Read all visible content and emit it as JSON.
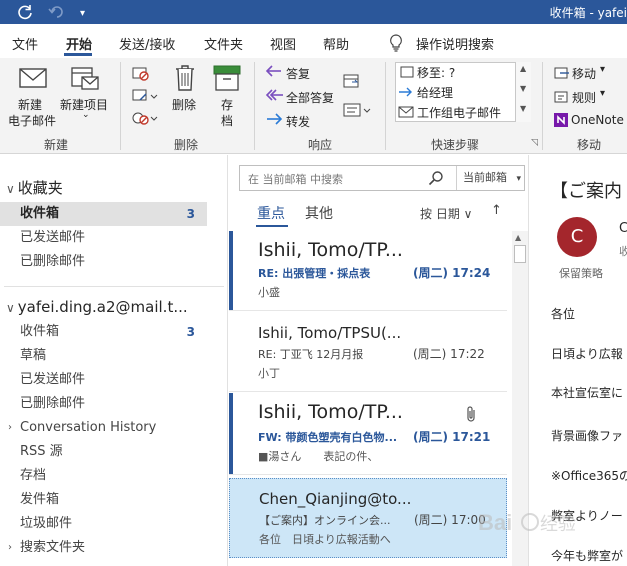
{
  "titlebar": {
    "title": "收件箱 - yafei",
    "sync_icon": "sync-icon",
    "undo_icon": "undo-icon",
    "customize_icon": "customize-quick-access-icon"
  },
  "tabs": [
    {
      "label": "文件"
    },
    {
      "label": "开始",
      "active": true
    },
    {
      "label": "发送/接收"
    },
    {
      "label": "文件夹"
    },
    {
      "label": "视图"
    },
    {
      "label": "帮助"
    }
  ],
  "tell_me": "操作说明搜索",
  "ribbon": {
    "new_email": "新建\n电子邮件",
    "new_email_l1": "新建",
    "new_email_l2": "电子邮件",
    "new_items": "新建项目",
    "group_new": "新建",
    "delete": "删除",
    "archive_l1": "存",
    "archive_l2": "档",
    "group_delete": "删除",
    "reply": "答复",
    "reply_all": "全部答复",
    "forward": "转发",
    "group_respond": "响应",
    "quick_steps": [
      {
        "label": "移至: ?"
      },
      {
        "label": "给经理"
      },
      {
        "label": "工作组电子邮件"
      }
    ],
    "group_quick_steps": "快速步骤",
    "move": "移动",
    "rules": "规则",
    "onenote": "OneNote",
    "group_move": "移动"
  },
  "nav": {
    "favorites": "收藏夹",
    "fav_items": [
      {
        "label": "收件箱",
        "count": "3",
        "selected": true
      },
      {
        "label": "已发送邮件"
      },
      {
        "label": "已删除邮件"
      }
    ],
    "account": "yafei.ding.a2@mail.t...",
    "account_items": [
      {
        "label": "收件箱",
        "count": "3"
      },
      {
        "label": "草稿"
      },
      {
        "label": "已发送邮件"
      },
      {
        "label": "已删除邮件"
      },
      {
        "label": "Conversation History",
        "expand": true
      },
      {
        "label": "RSS 源"
      },
      {
        "label": "存档"
      },
      {
        "label": "发件箱"
      },
      {
        "label": "垃圾邮件"
      },
      {
        "label": "搜索文件夹",
        "expand": true
      }
    ]
  },
  "list": {
    "search_placeholder": "在 当前邮箱 中搜索",
    "scope": "当前邮箱",
    "tab_focused": "重点",
    "tab_other": "其他",
    "sort": "按 日期 ∨",
    "sort_dir": "↑",
    "messages": [
      {
        "from": "Ishii, Tomo/TP...",
        "subject": "RE: 出張管理・採点表",
        "time": "(周二) 17:24",
        "preview": "小盛",
        "unread": true
      },
      {
        "from": "Ishii, Tomo/TPSU(...",
        "subject": "RE: 丁亚飞 12月月报",
        "time": "(周二) 17:22",
        "preview": "小丁",
        "unread": false
      },
      {
        "from": "Ishii, Tomo/TP...",
        "subject": "FW: 带颜色塑壳有白色物...",
        "time": "(周二) 17:21",
        "preview": "■湯さん　　表記の件、",
        "unread": true,
        "attachment": true
      },
      {
        "from": "Chen_Qianjing@to...",
        "subject": "【ご案内】オンライン会...",
        "time": "(周二) 17:00",
        "preview": "各位　日頃より広報活動へ",
        "unread": false,
        "selected": true
      }
    ]
  },
  "reading": {
    "subject": "【ご案内",
    "avatar_letter": "C",
    "sender": "C",
    "received": "收",
    "policy": "保留策略",
    "body": [
      "各位",
      "日頃より広報",
      "本社宣伝室に",
      "背景画像ファ",
      "※Office365の",
      "弊室よりノー",
      "今年も弊室が"
    ]
  },
  "watermark": "Baidu 经验",
  "colors": {
    "brand": "#2b579a",
    "avatar": "#a4262c",
    "selected_row": "#cde6f7"
  }
}
